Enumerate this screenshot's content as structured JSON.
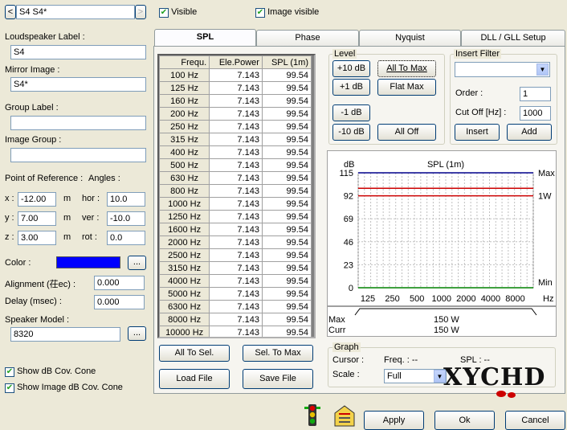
{
  "top": {
    "nav_left": "<",
    "title": "S4 S4*",
    "nav_right": ">",
    "visible_label": "Visible",
    "image_visible_label": "Image visible"
  },
  "left": {
    "ls_label_caption": "Loudspeaker Label :",
    "ls_label_value": "S4",
    "mirror_caption": "Mirror Image :",
    "mirror_value": "S4*",
    "group_caption": "Group Label :",
    "group_value": "",
    "image_group_caption": "Image Group :",
    "image_group_value": "",
    "por_caption": "Point of Reference :",
    "angles_caption": "Angles :",
    "x_label": "x :",
    "x_value": "-12.00",
    "y_label": "y :",
    "y_value": "7.00",
    "z_label": "z :",
    "z_value": "3.00",
    "m": "m",
    "hor_label": "hor :",
    "hor_value": "10.0",
    "ver_label": "ver :",
    "ver_value": "-10.0",
    "rot_label": "rot :",
    "rot_value": "0.0",
    "color_caption": "Color :",
    "color_value": "#0000ff",
    "ellipsis": "...",
    "alignment_caption": "Alignment (茌ec) :",
    "alignment_value": "0.000",
    "delay_caption": "Delay (msec) :",
    "delay_value": "0.000",
    "model_caption": "Speaker Model :",
    "model_value": "8320",
    "show_db_cone": "Show dB Cov. Cone",
    "show_img_db_cone": "Show Image dB Cov. Cone"
  },
  "tabs": [
    "SPL",
    "Phase",
    "Nyquist",
    "DLL / GLL Setup"
  ],
  "table": {
    "headers": [
      "Frequ.",
      "Ele.Power",
      "SPL (1m)"
    ],
    "rows": [
      [
        "100 Hz",
        "7.143",
        "99.54"
      ],
      [
        "125 Hz",
        "7.143",
        "99.54"
      ],
      [
        "160 Hz",
        "7.143",
        "99.54"
      ],
      [
        "200 Hz",
        "7.143",
        "99.54"
      ],
      [
        "250 Hz",
        "7.143",
        "99.54"
      ],
      [
        "315 Hz",
        "7.143",
        "99.54"
      ],
      [
        "400 Hz",
        "7.143",
        "99.54"
      ],
      [
        "500 Hz",
        "7.143",
        "99.54"
      ],
      [
        "630 Hz",
        "7.143",
        "99.54"
      ],
      [
        "800 Hz",
        "7.143",
        "99.54"
      ],
      [
        "1000 Hz",
        "7.143",
        "99.54"
      ],
      [
        "1250 Hz",
        "7.143",
        "99.54"
      ],
      [
        "1600 Hz",
        "7.143",
        "99.54"
      ],
      [
        "2000 Hz",
        "7.143",
        "99.54"
      ],
      [
        "2500 Hz",
        "7.143",
        "99.54"
      ],
      [
        "3150 Hz",
        "7.143",
        "99.54"
      ],
      [
        "4000 Hz",
        "7.143",
        "99.54"
      ],
      [
        "5000 Hz",
        "7.143",
        "99.54"
      ],
      [
        "6300 Hz",
        "7.143",
        "99.54"
      ],
      [
        "8000 Hz",
        "7.143",
        "99.54"
      ],
      [
        "10000 Hz",
        "7.143",
        "99.54"
      ]
    ]
  },
  "level": {
    "caption": "Level",
    "plus10": "+10 dB",
    "plus1": "+1 dB",
    "minus1": "-1 dB",
    "minus10": "-10 dB",
    "all_to_max": "All To Max",
    "flat_max": "Flat Max",
    "all_off": "All Off"
  },
  "insert": {
    "caption": "Insert Filter",
    "order_label": "Order :",
    "order_value": "1",
    "cutoff_label": "Cut Off [Hz] :",
    "cutoff_value": "1000",
    "insert_btn": "Insert",
    "add_btn": "Add"
  },
  "chart_data": {
    "type": "line",
    "title": "SPL (1m)",
    "ylabel": "dB",
    "ylim": [
      0,
      115
    ],
    "yticks": [
      0,
      23,
      46,
      69,
      92,
      115
    ],
    "x": [
      "125",
      "250",
      "500",
      "1000",
      "2000",
      "4000",
      "8000"
    ],
    "xunit": "Hz",
    "series": [
      {
        "name": "Max",
        "value": 115,
        "color": "#00008b"
      },
      {
        "name": "1W",
        "value": 92,
        "color": "#cc0000"
      },
      {
        "name": "",
        "value": 99.54,
        "color": "#cc0000"
      },
      {
        "name": "Min",
        "value": 0,
        "color": "#008000"
      }
    ],
    "max_label": "Max",
    "w1_label": "1W",
    "min_label": "Min",
    "grid": true
  },
  "power": {
    "max_label": "Max",
    "curr_label": "Curr",
    "max_value": "150 W",
    "curr_value": "150 W"
  },
  "bottom_btns": {
    "all_to_sel": "All To Sel.",
    "sel_to_max": "Sel. To Max",
    "load_file": "Load File",
    "save_file": "Save File"
  },
  "graph": {
    "caption": "Graph",
    "cursor_label": "Cursor :",
    "freq_label": "Freq. : --",
    "spl_label": "SPL : --",
    "scale_label": "Scale :",
    "scale_value": "Full",
    "logo": "XYCHD",
    ".com": ".com"
  },
  "footer": {
    "apply": "Apply",
    "ok": "Ok",
    "cancel": "Cancel"
  }
}
